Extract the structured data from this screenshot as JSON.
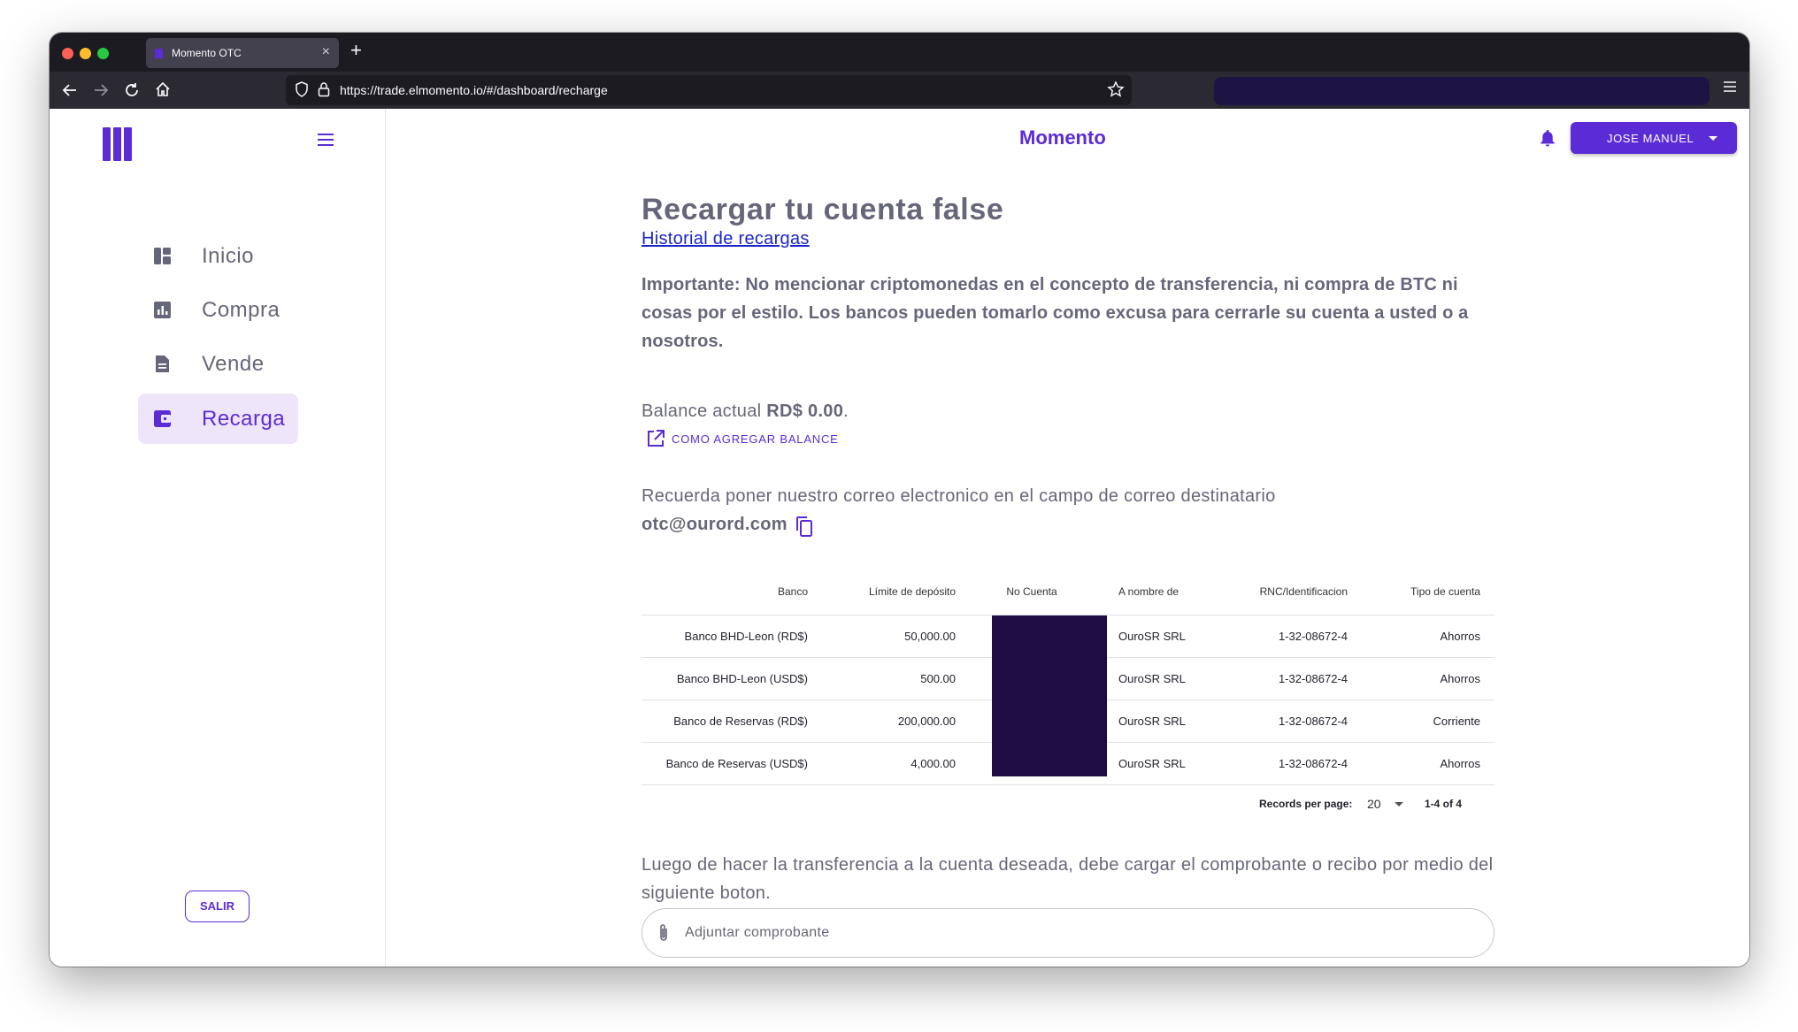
{
  "browser": {
    "tab_title": "Momento OTC",
    "tab_close": "×",
    "new_tab": "+",
    "url": "https://trade.elmomento.io/#/dashboard/recharge"
  },
  "colors": {
    "brand": "#5b2bd6",
    "active_bg": "#efe5fb",
    "text": "#66667a",
    "redaction": "#1e0d45",
    "link": "#1a24c9"
  },
  "sidebar": {
    "items": [
      {
        "label": "Inicio",
        "icon": "dashboard-icon"
      },
      {
        "label": "Compra",
        "icon": "chart-icon"
      },
      {
        "label": "Vende",
        "icon": "document-icon"
      },
      {
        "label": "Recarga",
        "icon": "wallet-icon",
        "active": true
      }
    ],
    "logout_label": "SALIR"
  },
  "header": {
    "brand": "Momento",
    "user_label": "JOSE MANUEL"
  },
  "main": {
    "title": "Recargar tu cuenta false",
    "history_link": "Historial de recargas",
    "important": "Importante: No mencionar criptomonedas en el concepto de transferencia, ni compra de BTC ni cosas por el estilo. Los bancos pueden tomarlo como excusa para cerrarle su cuenta a usted o a nosotros.",
    "balance_label": "Balance actual ",
    "balance_value": "RD$ 0.00",
    "balance_suffix": ".",
    "howto_label": "COMO AGREGAR BALANCE",
    "remember_text": "Recuerda poner nuestro correo electronico en el campo de correo destinatario",
    "email": "otc@ourord.com",
    "after_text": "Luego de hacer la transferencia a la cuenta deseada, debe cargar el comprobante o recibo por medio del siguiente boton.",
    "attach_label": "Adjuntar comprobante"
  },
  "table": {
    "headers": [
      "Banco",
      "Límite de depósito",
      "No Cuenta",
      "A nombre de",
      "RNC/Identificacion",
      "Tipo de cuenta"
    ],
    "rows": [
      [
        "Banco BHD-Leon (RD$)",
        "50,000.00",
        "",
        "OuroSR SRL",
        "1-32-08672-4",
        "Ahorros"
      ],
      [
        "Banco BHD-Leon (USD$)",
        "500.00",
        "",
        "OuroSR SRL",
        "1-32-08672-4",
        "Ahorros"
      ],
      [
        "Banco de Reservas (RD$)",
        "200,000.00",
        "",
        "OuroSR SRL",
        "1-32-08672-4",
        "Corriente"
      ],
      [
        "Banco de Reservas (USD$)",
        "4,000.00",
        "",
        "OuroSR SRL",
        "1-32-08672-4",
        "Ahorros"
      ]
    ],
    "records_per_page_label": "Records per page:",
    "records_per_page": "20",
    "range": "1-4 of 4"
  }
}
